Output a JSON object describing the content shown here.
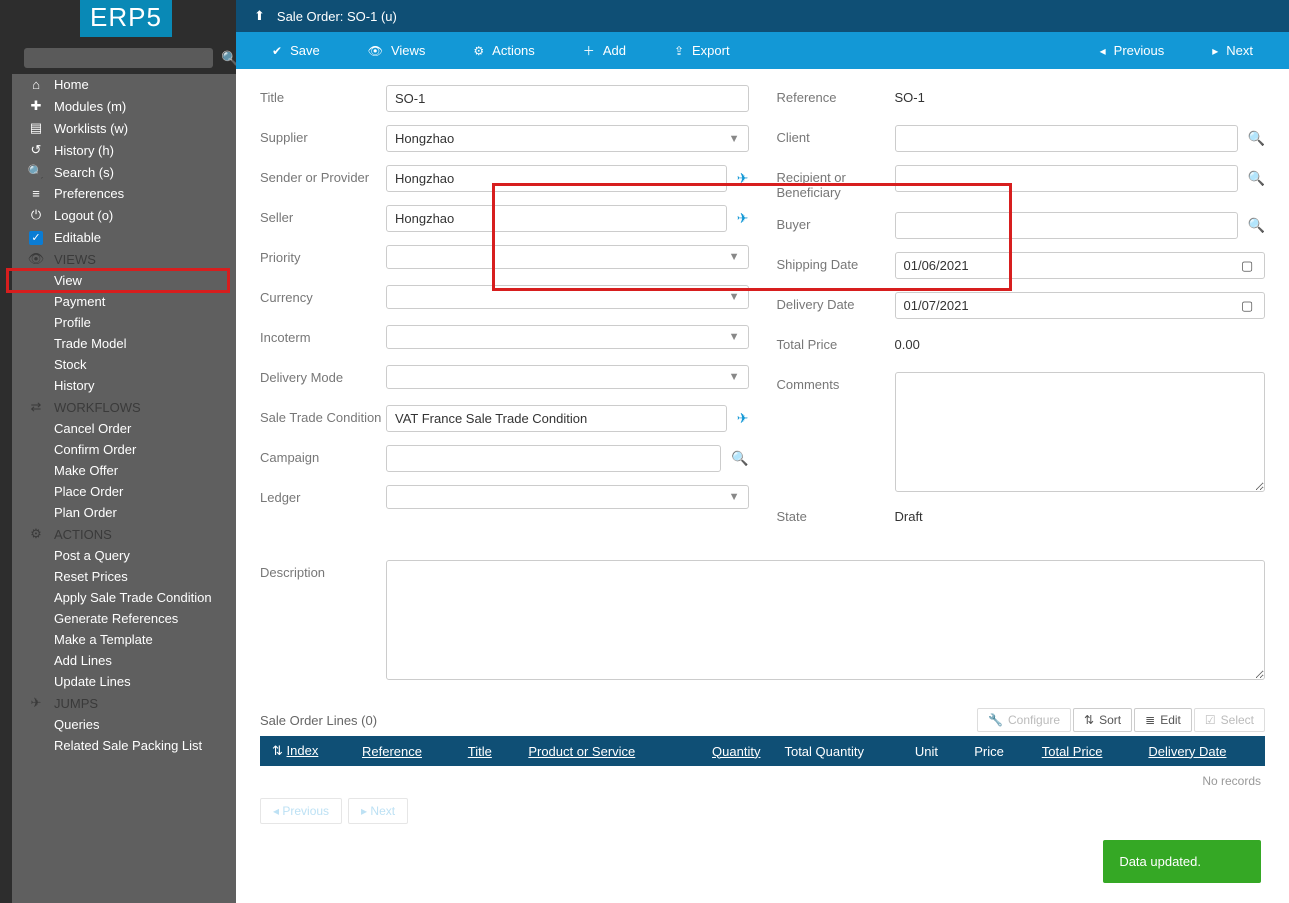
{
  "logo": "ERP5",
  "sidebar": {
    "search_placeholder": "",
    "items": [
      {
        "icon": "⌂",
        "label": "Home"
      },
      {
        "icon": "✚",
        "label": "Modules (m)"
      },
      {
        "icon": "▤",
        "label": "Worklists (w)"
      },
      {
        "icon": "↺",
        "label": "History (h)"
      },
      {
        "icon": "🔍",
        "label": "Search (s)"
      },
      {
        "icon": "≡",
        "label": "Preferences"
      },
      {
        "icon": "⏻",
        "label": "Logout (o)"
      }
    ],
    "editable_label": "Editable",
    "sections": {
      "views": {
        "icon": "👁",
        "label": "VIEWS",
        "subs": [
          "View",
          "Payment",
          "Profile",
          "Trade Model",
          "Stock",
          "History"
        ]
      },
      "workflows": {
        "icon": "⇄",
        "label": "WORKFLOWS",
        "subs": [
          "Cancel Order",
          "Confirm Order",
          "Make Offer",
          "Place Order",
          "Plan Order"
        ]
      },
      "actions": {
        "icon": "⚙",
        "label": "ACTIONS",
        "subs": [
          "Post a Query",
          "Reset Prices",
          "Apply Sale Trade Condition",
          "Generate References",
          "Make a Template",
          "Add Lines",
          "Update Lines"
        ]
      },
      "jumps": {
        "icon": "✈",
        "label": "JUMPS",
        "subs": [
          "Queries",
          "Related Sale Packing List"
        ]
      }
    }
  },
  "breadcrumb": "Sale Order: SO-1 (u)",
  "actionbar": {
    "save": "Save",
    "views": "Views",
    "actions": "Actions",
    "add": "Add",
    "export": "Export",
    "previous": "Previous",
    "next": "Next"
  },
  "form": {
    "title_label": "Title",
    "title_value": "SO-1",
    "supplier_label": "Supplier",
    "supplier_value": "Hongzhao",
    "sender_label": "Sender or Provider",
    "sender_value": "Hongzhao",
    "seller_label": "Seller",
    "seller_value": "Hongzhao",
    "priority_label": "Priority",
    "priority_value": "",
    "currency_label": "Currency",
    "currency_value": "",
    "incoterm_label": "Incoterm",
    "incoterm_value": "",
    "deliverymode_label": "Delivery Mode",
    "deliverymode_value": "",
    "stc_label": "Sale Trade Condition",
    "stc_value": "VAT France Sale Trade Condition",
    "campaign_label": "Campaign",
    "campaign_value": "",
    "ledger_label": "Ledger",
    "ledger_value": "",
    "description_label": "Description",
    "description_value": "",
    "reference_label": "Reference",
    "reference_value": "SO-1",
    "client_label": "Client",
    "client_value": "",
    "recipient_label": "Recipient or Beneficiary",
    "recipient_value": "",
    "buyer_label": "Buyer",
    "buyer_value": "",
    "shippingdate_label": "Shipping Date",
    "shippingdate_value": "01/06/2021",
    "deliverydate_label": "Delivery Date",
    "deliverydate_value": "01/07/2021",
    "totalprice_label": "Total Price",
    "totalprice_value": "0.00",
    "comments_label": "Comments",
    "comments_value": "",
    "state_label": "State",
    "state_value": "Draft"
  },
  "lines": {
    "title": "Sale Order Lines (0)",
    "tools": {
      "configure": "Configure",
      "sort": "Sort",
      "edit": "Edit",
      "select": "Select"
    },
    "columns": [
      "Index",
      "Reference",
      "Title",
      "Product or Service",
      "Quantity",
      "Total Quantity",
      "Unit",
      "Price",
      "Total Price",
      "Delivery Date"
    ],
    "no_records": "No records",
    "pager_prev": "Previous",
    "pager_next": "Next"
  },
  "toast": "Data updated."
}
